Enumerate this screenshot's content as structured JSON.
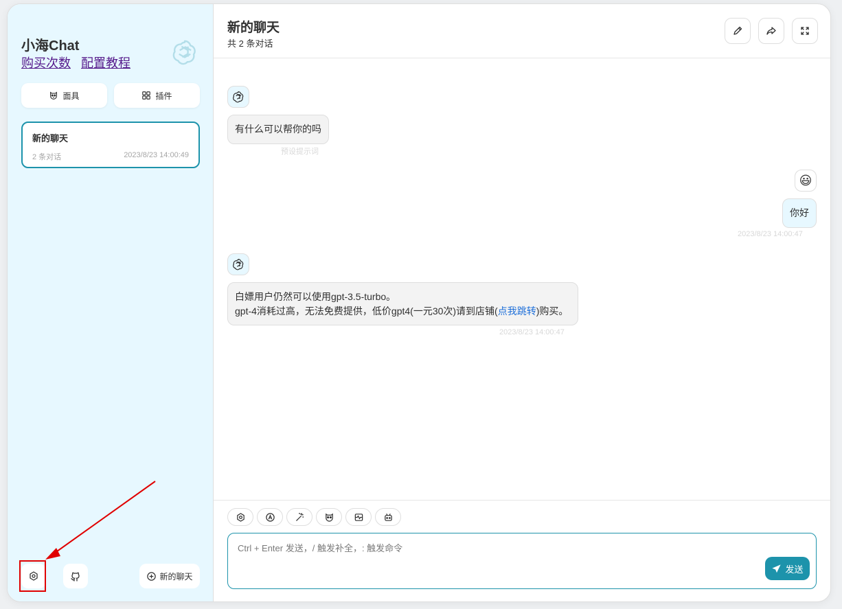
{
  "sidebar": {
    "title": "小海Chat",
    "links": [
      "购买次数",
      "配置教程"
    ],
    "mask_button": "面具",
    "plugin_button": "插件",
    "chat_items": [
      {
        "title": "新的聊天",
        "count": "2 条对话",
        "time": "2023/8/23 14:00:49"
      }
    ],
    "new_chat_button": "新的聊天"
  },
  "header": {
    "title": "新的聊天",
    "subtitle": "共 2 条对话"
  },
  "messages": [
    {
      "role": "bot",
      "text": "有什么可以帮你的吗",
      "meta": "预设提示词"
    },
    {
      "role": "user",
      "text": "你好",
      "meta": "2023/8/23 14:00:47"
    },
    {
      "role": "bot",
      "line1": "白嫖用户仍然可以使用gpt-3.5-turbo。",
      "line2_pre": "gpt-4消耗过高，无法免费提供，低价gpt4(一元30次)请到店铺(",
      "link": "点我跳转",
      "line2_post": ")购买。",
      "meta": "2023/8/23 14:00:47"
    }
  ],
  "input": {
    "placeholder": "Ctrl + Enter 发送，/ 触发补全，: 触发命令",
    "send_label": "发送"
  },
  "colors": {
    "primary": "#1d93ab",
    "sidebar_bg": "#e7f8ff",
    "highlight": "#e00000"
  }
}
